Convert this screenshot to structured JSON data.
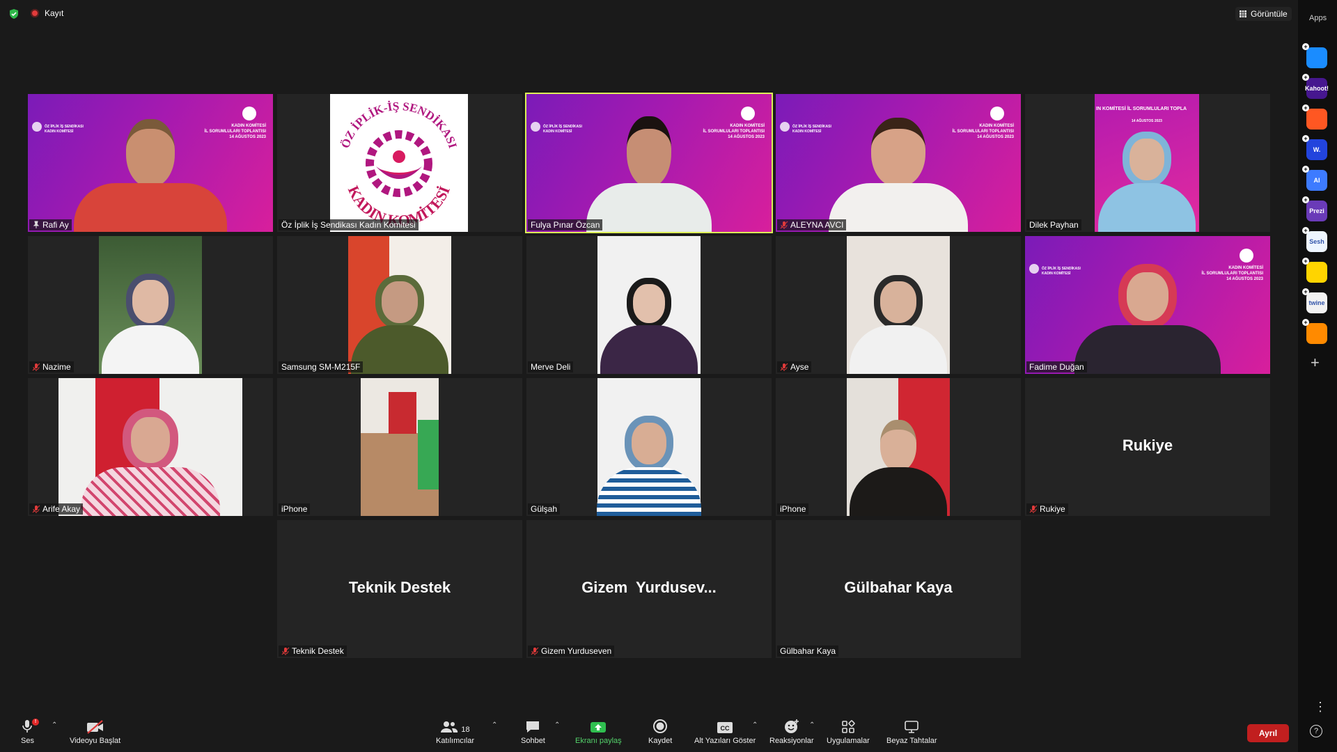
{
  "top_bar": {
    "recording_label": "Kayıt",
    "view_label": "Görüntüle"
  },
  "apps_panel": {
    "title": "Apps",
    "apps": [
      {
        "name": "Flip",
        "label": "",
        "color": "#1a8cff"
      },
      {
        "name": "Kahoot!",
        "label": "Kahoot!",
        "color": "#46178f"
      },
      {
        "name": "Tomato",
        "label": "",
        "color": "#ff5722"
      },
      {
        "name": "Wooclap",
        "label": "W.",
        "color": "#2244dd"
      },
      {
        "name": "AI Assistant",
        "label": "AI",
        "color": "#3d7bff"
      },
      {
        "name": "Prezi",
        "label": "Prezi",
        "color": "#6a3bb8"
      },
      {
        "name": "Sesh",
        "label": "Sesh",
        "color": "#eef6ff"
      },
      {
        "name": "Emoji app",
        "label": "",
        "color": "#ffd400"
      },
      {
        "name": "Twine",
        "label": "twine",
        "color": "#f2f2f2"
      },
      {
        "name": "Multi app",
        "label": "",
        "color": "#ff8a00"
      }
    ]
  },
  "participants": [
    {
      "name": "Rafi Ay",
      "icon": "pin"
    },
    {
      "name": "Öz İplik İş Sendikası Kadın Komitesi",
      "icon": "none"
    },
    {
      "name": "Fulya Pınar Özcan",
      "icon": "none"
    },
    {
      "name": "ALEYNA AVCI",
      "icon": "mic-off"
    },
    {
      "name": "Dilek Payhan",
      "icon": "none"
    },
    {
      "name": "Nazime",
      "icon": "mic-off"
    },
    {
      "name": "Samsung SM-M215F",
      "icon": "none"
    },
    {
      "name": "Merve Deli",
      "icon": "none"
    },
    {
      "name": "Ayse",
      "icon": "mic-off"
    },
    {
      "name": "Fadime Duğan",
      "icon": "none"
    },
    {
      "name": "Arife Akay",
      "icon": "mic-off"
    },
    {
      "name": "iPhone",
      "icon": "none"
    },
    {
      "name": "Gülşah",
      "icon": "none"
    },
    {
      "name": "iPhone",
      "icon": "none"
    },
    {
      "name": "Rukiye",
      "icon": "mic-off",
      "display": "Rukiye"
    },
    {
      "name": "Teknik Destek",
      "icon": "mic-off",
      "display": "Teknik Destek"
    },
    {
      "name": "Gizem Yurduseven",
      "icon": "mic-off",
      "display": "Gizem  Yurdusev..."
    },
    {
      "name": "Gülbahar Kaya",
      "icon": "none",
      "display": "Gülbahar Kaya"
    }
  ],
  "banner": {
    "line1": "KADIN KOMİTESİ",
    "line2": "İL SORUMLULARI TOPLANTISI",
    "date": "14 AĞUSTOS 2023",
    "union": "ÖZ İPLİK İŞ SENDİKASI",
    "committee": "KADIN KOMİTESİ",
    "crop_title": "IN KOMİTESİ İL SORUMLULARI TOPLA"
  },
  "logo": {
    "top_text": "ÖZ İPLİK-İŞ SENDİKASI",
    "bottom_text": "KADIN KOMİTESİ"
  },
  "toolbar": {
    "audio_label": "Ses",
    "audio_badge": "!",
    "video_label": "Videoyu Başlat",
    "participants_label": "Katılımcılar",
    "participants_count": "18",
    "chat_label": "Sohbet",
    "share_label": "Ekranı paylaş",
    "record_label": "Kaydet",
    "captions_label": "Alt Yazıları Göster",
    "reactions_label": "Reaksiyonlar",
    "apps_label": "Uygulamalar",
    "whiteboard_label": "Beyaz Tahtalar",
    "leave_label": "Ayrıl"
  }
}
